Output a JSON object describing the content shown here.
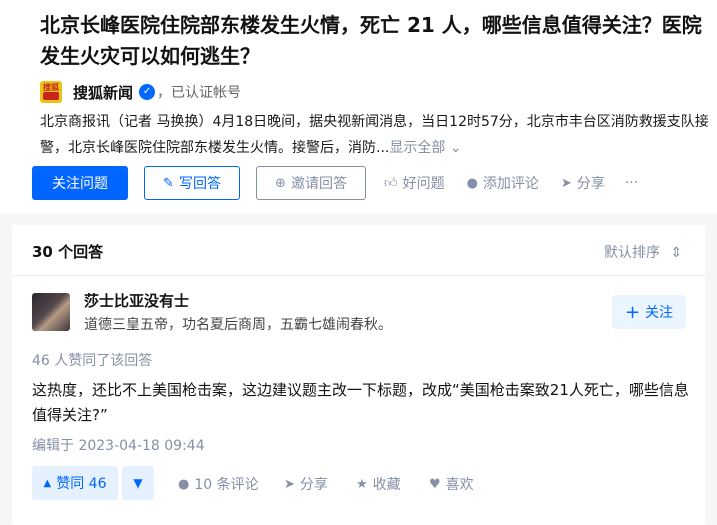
{
  "question": {
    "title": "北京长峰医院住院部东楼发生火情，死亡 21 人，哪些信息值得关注？医院发生火灾可以如何逃生？",
    "author": {
      "logo_text": "搜狐",
      "name": "搜狐新闻",
      "verified_text": "，已认证帐号"
    },
    "excerpt": "北京商报讯（记者 马换换）4月18日晚间，据央视新闻消息，当日12时57分，北京市丰台区消防救援支队接警，北京长峰医院住院部东楼发生火情。接警后，消防...",
    "show_all": "显示全部",
    "actions": {
      "follow_question": "关注问题",
      "write_answer": "写回答",
      "invite_answer": "邀请回答",
      "good_question": "好问题",
      "add_comment": "添加评论",
      "share": "分享",
      "more": "···"
    }
  },
  "answers": {
    "count_label": "30 个回答",
    "sort_label": "默认排序",
    "first": {
      "author_name": "莎士比亚没有士",
      "author_bio": "道德三皇五帝，功名夏后商周，五霸七雄闹春秋。",
      "follow_label": "关注",
      "votes_note": "46 人赞同了该回答",
      "body": "这热度，还比不上美国枪击案，这边建议题主改一下标题，改成“美国枪击案致21人死亡，哪些信息值得关注?”",
      "edited": "编辑于 2023-04-18 09:44",
      "upvote_label": "赞同 46",
      "comments_label": "10 条评论",
      "share_label": "分享",
      "collect_label": "收藏",
      "like_label": "喜欢"
    }
  },
  "colors": {
    "primary": "#0066ff",
    "muted": "#8590a6"
  }
}
